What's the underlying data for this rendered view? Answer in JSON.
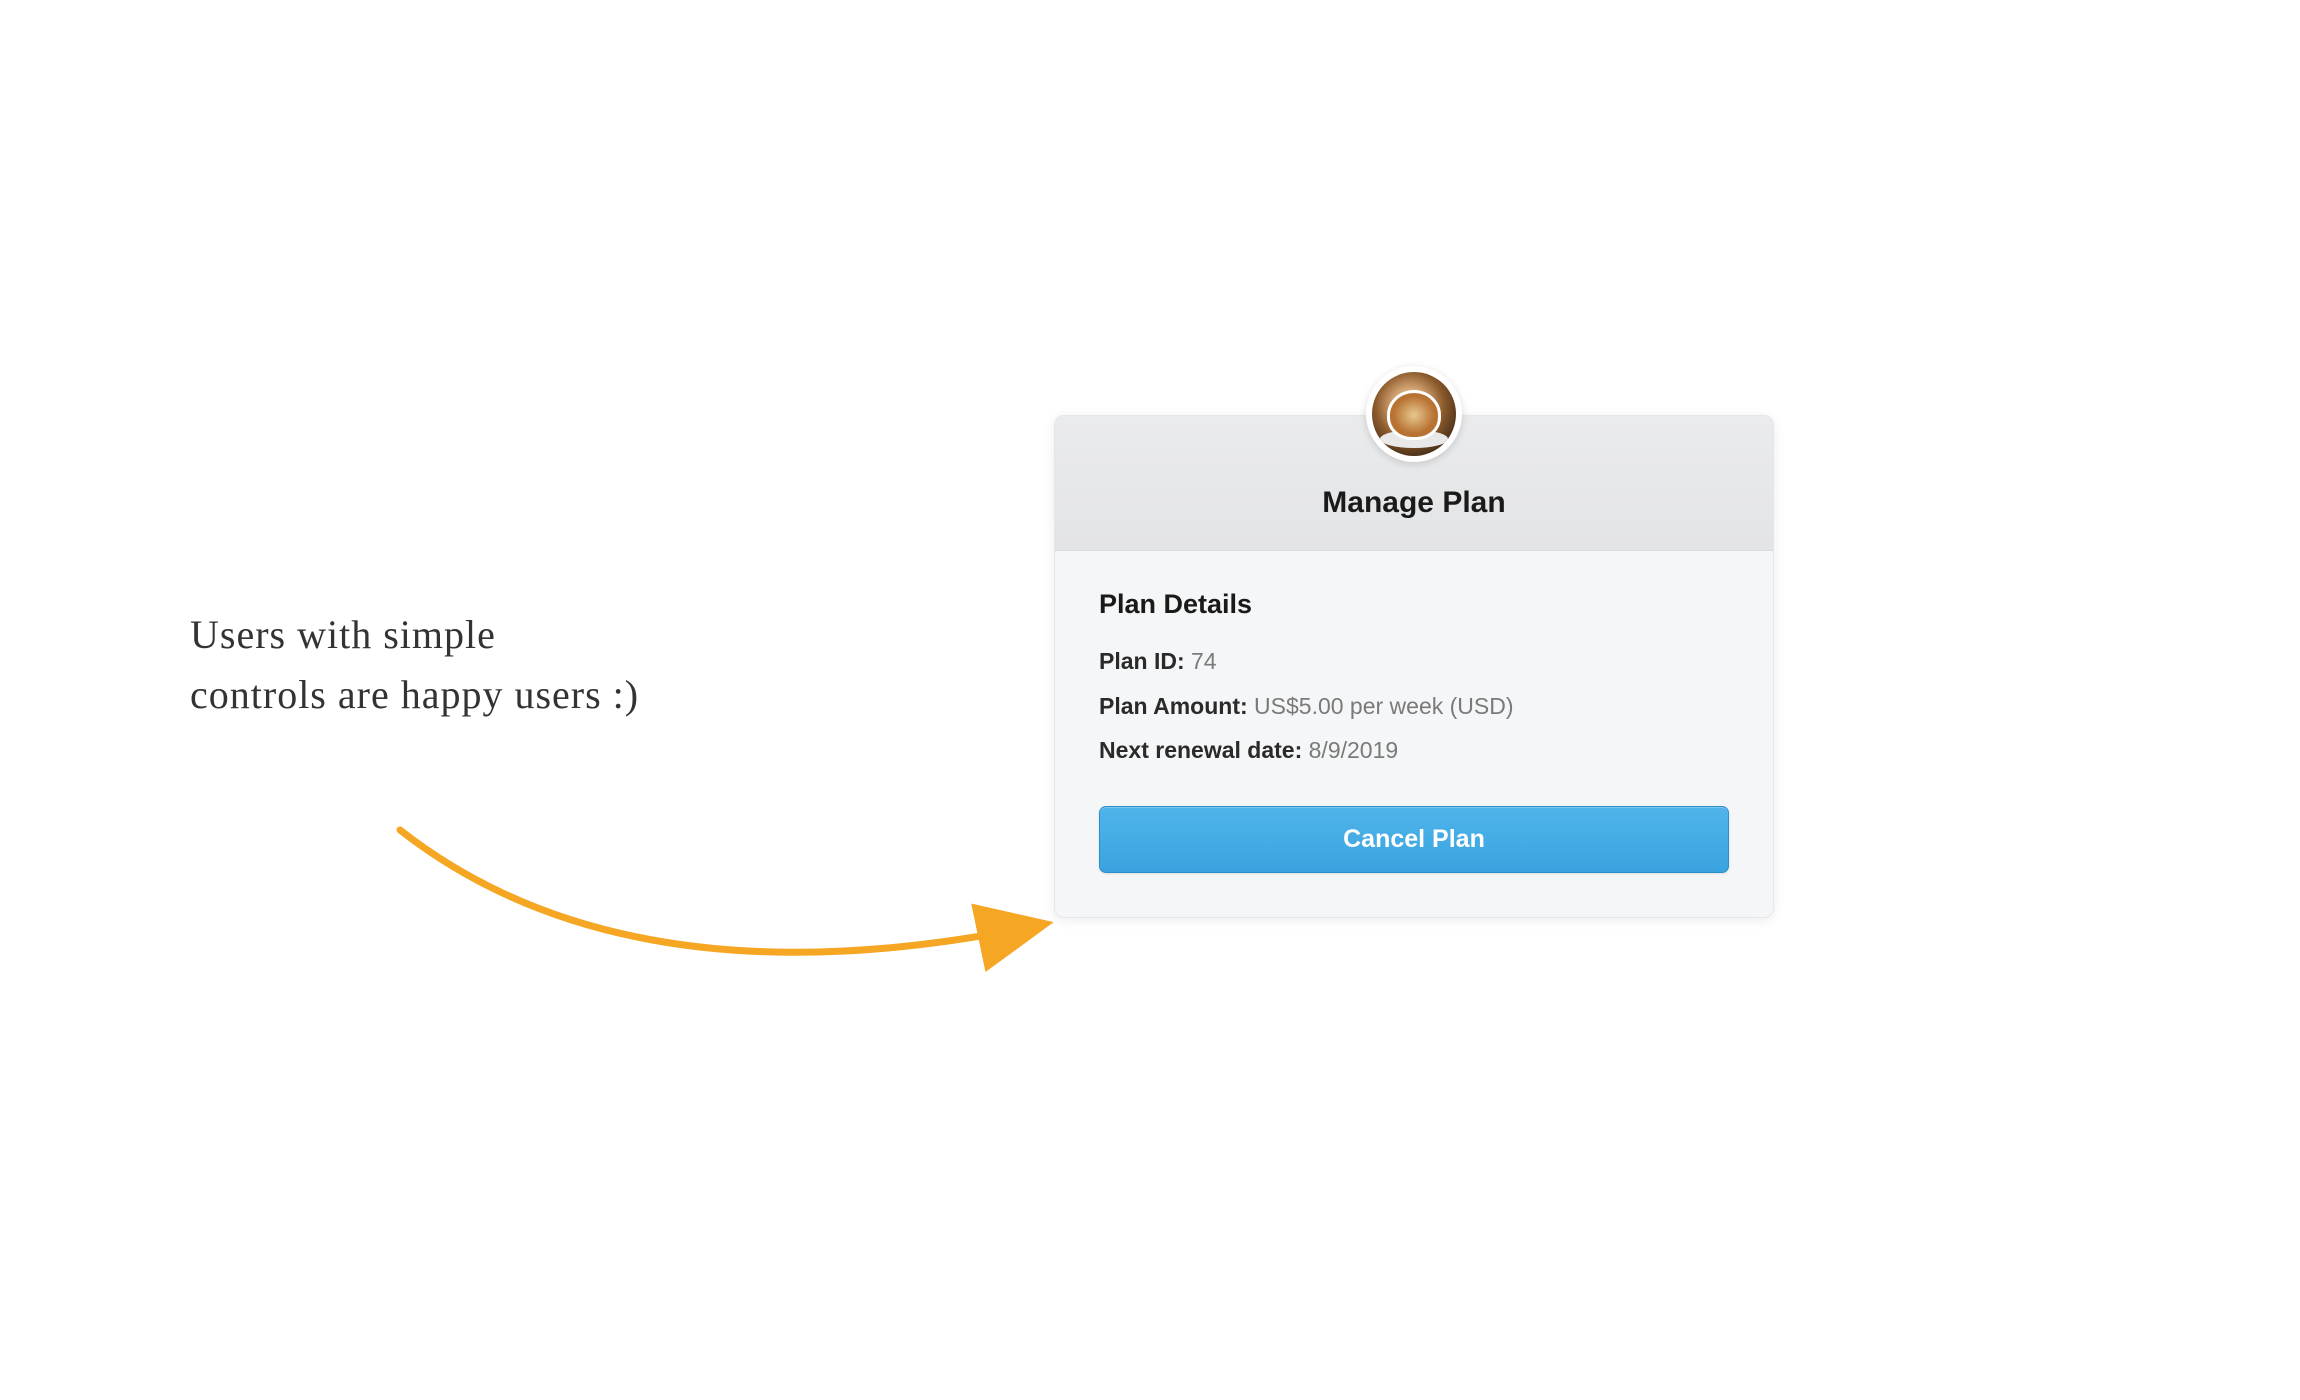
{
  "annotation": {
    "text": "Users with simple controls are happy users :)"
  },
  "card": {
    "title": "Manage Plan",
    "section_heading": "Plan Details",
    "details": {
      "plan_id_label": "Plan ID:",
      "plan_id_value": "74",
      "plan_amount_label": "Plan Amount:",
      "plan_amount_value": "US$5.00 per week (USD)",
      "next_renewal_label": "Next renewal date:",
      "next_renewal_value": "8/9/2019"
    },
    "cancel_button_label": "Cancel Plan"
  },
  "colors": {
    "accent": "#3aa3df",
    "arrow": "#f5a623"
  }
}
